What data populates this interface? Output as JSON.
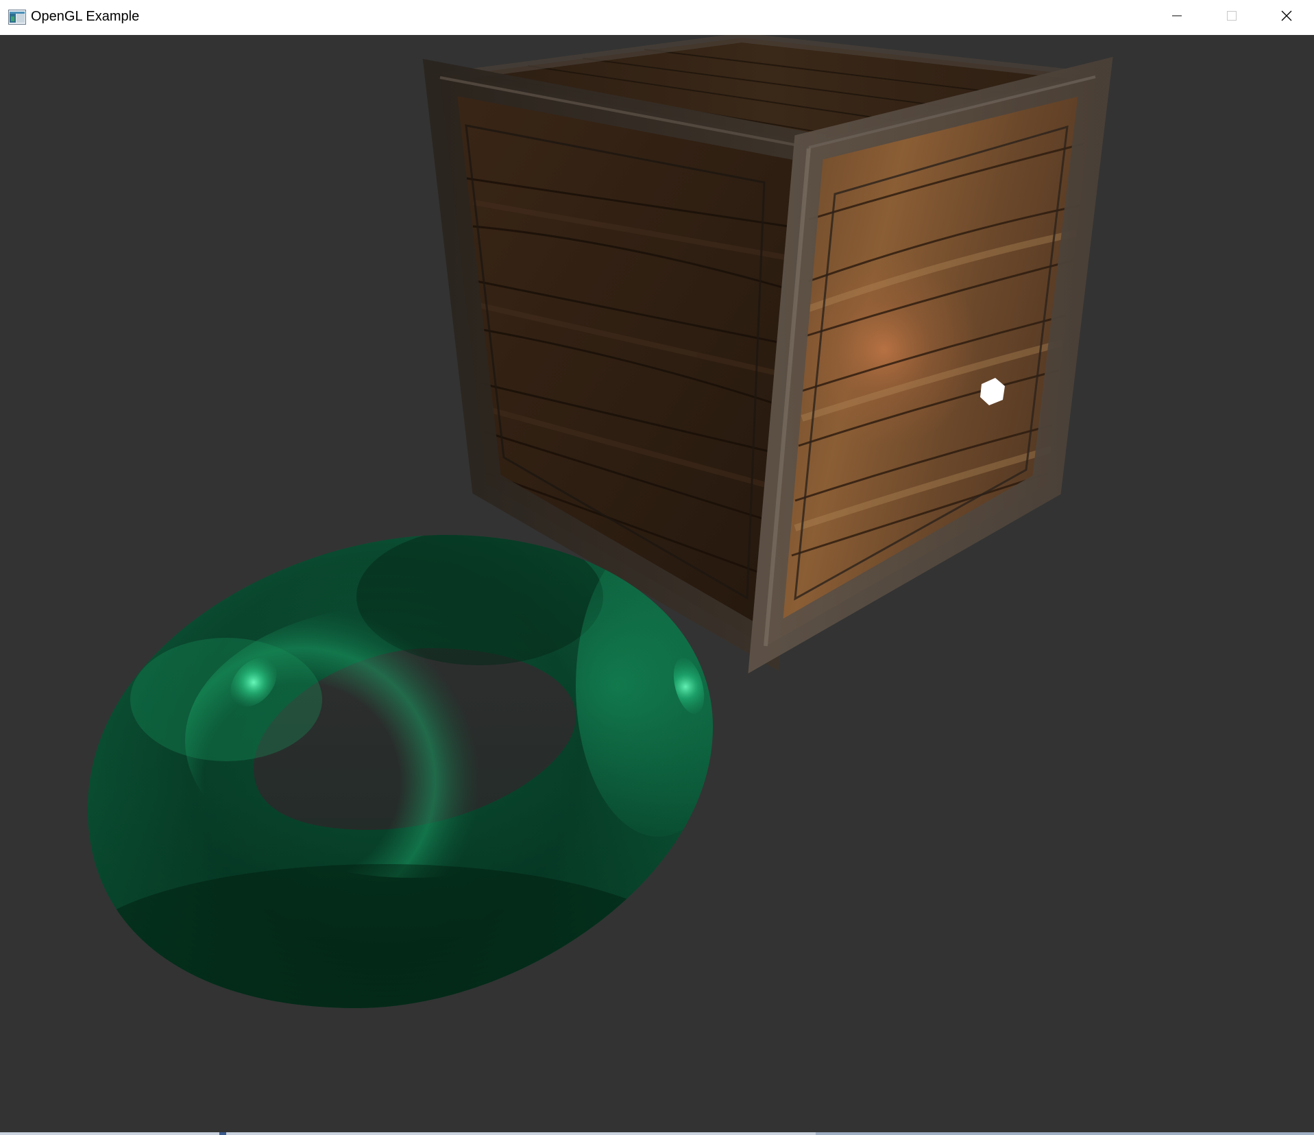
{
  "window": {
    "title": "OpenGL Example",
    "title_icon": "app-window-icon",
    "controls": {
      "minimize_icon": "minimize-icon",
      "maximize_icon": "maximize-icon",
      "close_icon": "close-icon"
    }
  },
  "scene": {
    "background_color": "#333333",
    "objects": [
      {
        "name": "wooden-crate",
        "color": "#5a3d25"
      },
      {
        "name": "green-torus",
        "color": "#0f6b45"
      },
      {
        "name": "light-source-cube",
        "color": "#ffffff"
      }
    ]
  }
}
